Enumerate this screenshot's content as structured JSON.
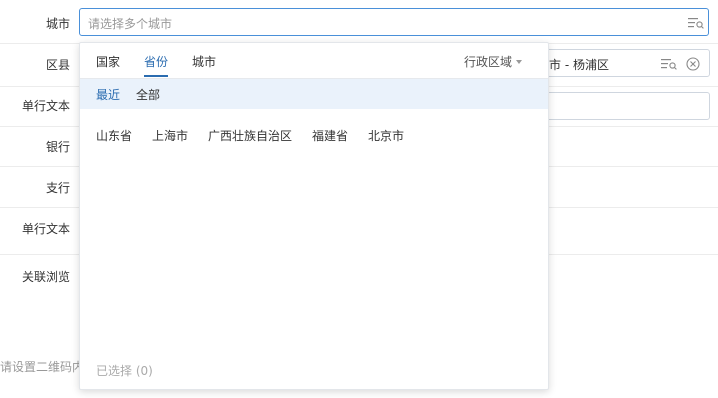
{
  "form": {
    "rows": [
      {
        "label": "城市"
      },
      {
        "label": "区县"
      },
      {
        "label": "单行文本"
      },
      {
        "label": "银行"
      },
      {
        "label": "支行"
      },
      {
        "label": "单行文本"
      },
      {
        "label": "关联浏览"
      }
    ],
    "city_field": {
      "placeholder": "请选择多个城市"
    },
    "district_field": {
      "value": "市 - 杨浦区"
    },
    "qr_hint": "请设置二维码内"
  },
  "popup": {
    "tabs": [
      {
        "label": "国家"
      },
      {
        "label": "省份",
        "active": true
      },
      {
        "label": "城市"
      }
    ],
    "region_label": "行政区域",
    "subtabs": [
      {
        "label": "最近",
        "active": true
      },
      {
        "label": "全部"
      }
    ],
    "options": [
      "山东省",
      "上海市",
      "广西壮族自治区",
      "福建省",
      "北京市"
    ],
    "selected_count_text": "已选择 (0)"
  },
  "colors": {
    "accent": "#2b6cb0",
    "subtab_bg": "#eaf2fb",
    "field_focus_border": "#4a90d9"
  },
  "icons": [
    "filter-icon",
    "clear-icon",
    "caret-down-icon"
  ]
}
